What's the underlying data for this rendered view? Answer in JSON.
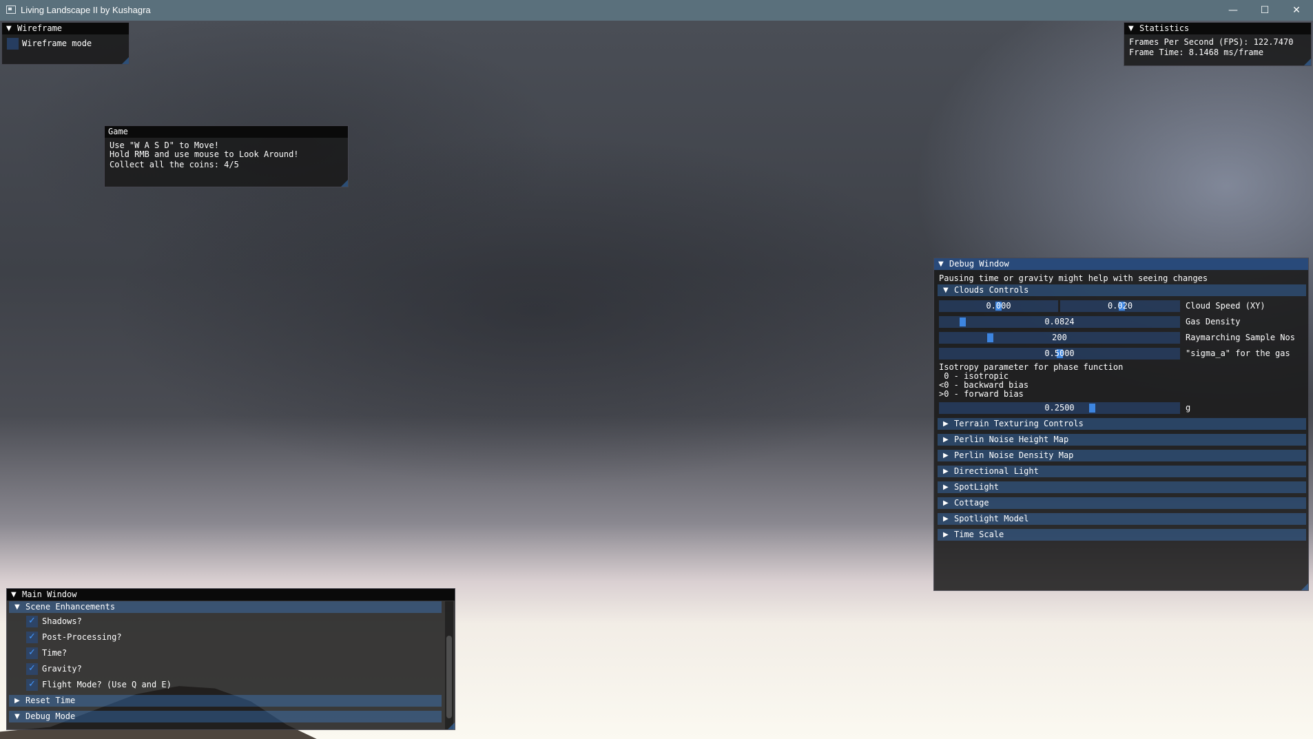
{
  "window": {
    "title": "Living Landscape II by Kushagra",
    "minimize": "—",
    "maximize": "☐",
    "close": "✕"
  },
  "wireframe": {
    "title": "Wireframe",
    "checkbox_label": "Wireframe mode",
    "checked": false
  },
  "statistics": {
    "title": "Statistics",
    "fps": "Frames Per Second (FPS): 122.7470",
    "frame_time": "Frame Time: 8.1468 ms/frame"
  },
  "game": {
    "title": "Game",
    "line1": "Use \"W A S D\" to Move!",
    "line2": "Hold RMB and use mouse to Look Around!",
    "coins": "Collect all the coins: 4/5",
    "coins_collected": 4,
    "coins_total": 5
  },
  "debug": {
    "title": "Debug Window",
    "hint": "Pausing time or gravity might help with seeing changes",
    "clouds_header": "Clouds Controls",
    "cloud_speed": {
      "x": "0.000",
      "y": "0.020",
      "label": "Cloud Speed (XY)"
    },
    "gas_density": {
      "value": "0.0824",
      "label": "Gas Density"
    },
    "raymarch": {
      "value": "200",
      "label": "Raymarching Sample Nos"
    },
    "sigma": {
      "value": "0.5000",
      "label": "\"sigma_a\" for the gas"
    },
    "isotropy_text": {
      "l1": "Isotropy parameter for phase function",
      "l2": " 0 - isotropic",
      "l3": "<0 - backward bias",
      "l4": ">0 - forward bias"
    },
    "g": {
      "value": "0.2500",
      "label": "g"
    },
    "collapsed": [
      "Terrain Texturing Controls",
      "Perlin Noise Height Map",
      "Perlin Noise Density Map",
      "Directional Light",
      "SpotLight",
      "Cottage",
      "Spotlight Model",
      "Time Scale"
    ]
  },
  "main": {
    "title": "Main Window",
    "scene_header": "Scene Enhancements",
    "options": [
      {
        "label": "Shadows?",
        "checked": true
      },
      {
        "label": "Post-Processing?",
        "checked": true
      },
      {
        "label": "Time?",
        "checked": true
      },
      {
        "label": "Gravity?",
        "checked": true
      },
      {
        "label": "Flight Mode? (Use Q and E)",
        "checked": true
      }
    ],
    "reset_time": "Reset Time",
    "debug_mode": "Debug Mode"
  }
}
